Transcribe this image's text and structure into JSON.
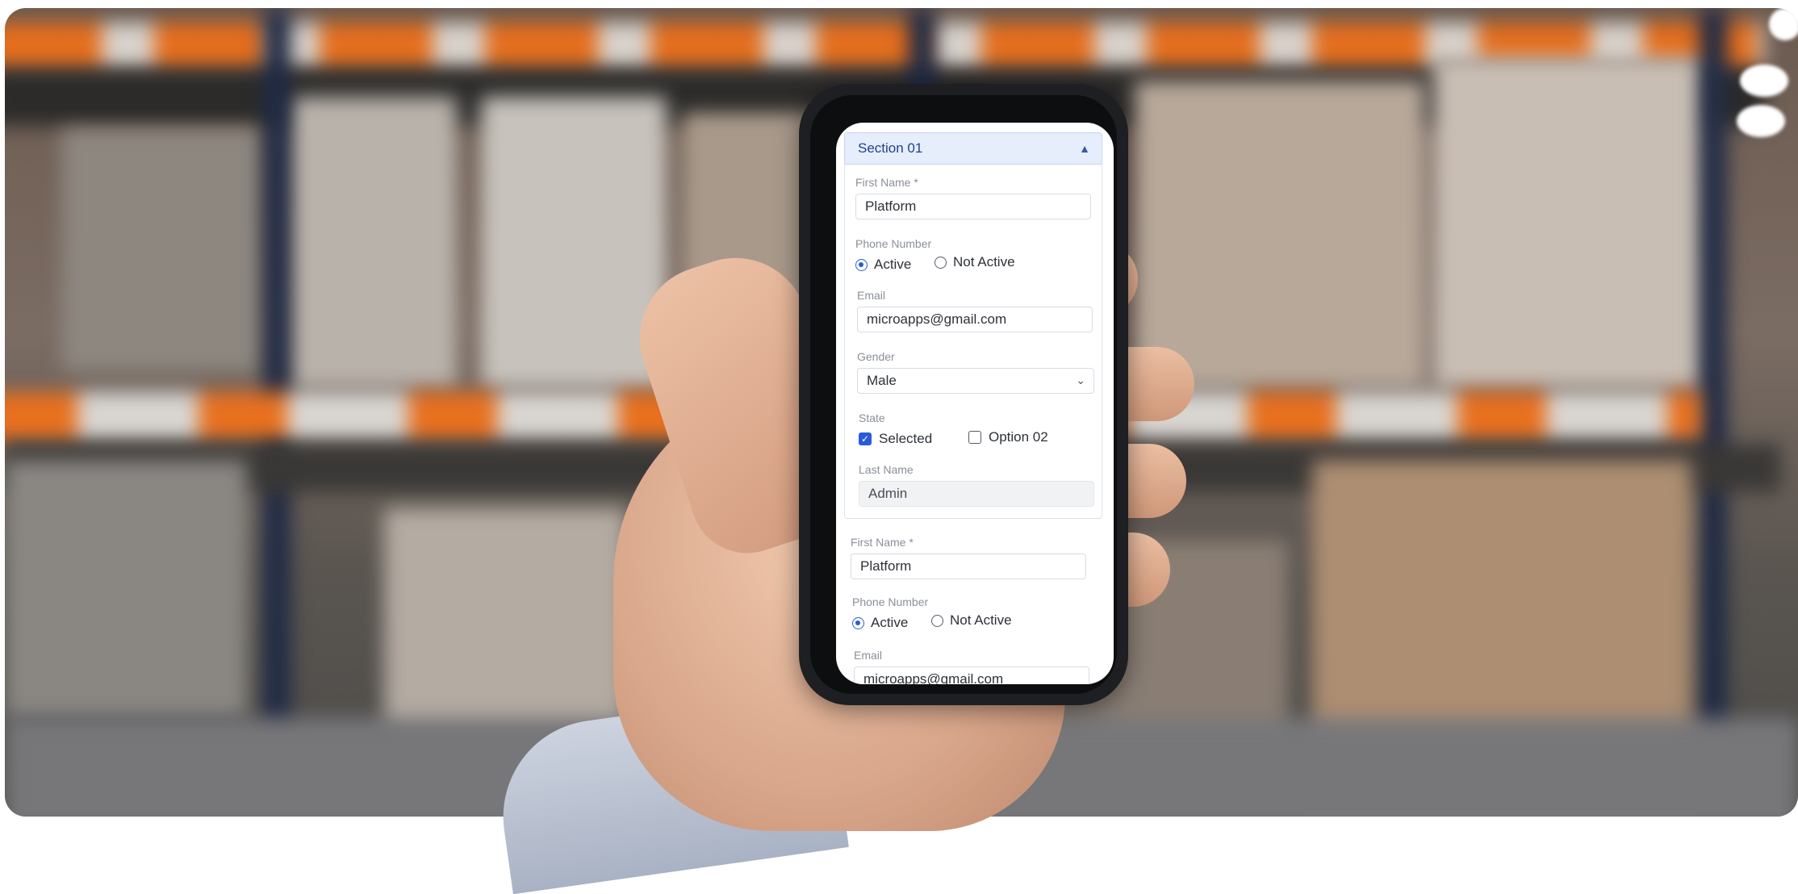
{
  "section": {
    "title": "Section 01"
  },
  "form1": {
    "first_name_label": "First Name *",
    "first_name_value": "Platform",
    "phone_label": "Phone Number",
    "radio_active": "Active",
    "radio_not_active": "Not Active",
    "email_label": "Email",
    "email_value": "microapps@gmail.com",
    "gender_label": "Gender",
    "gender_value": "Male",
    "state_label": "State",
    "check_selected": "Selected",
    "check_option2": "Option 02",
    "last_name_label": "Last Name",
    "last_name_value": "Admin"
  },
  "form2": {
    "first_name_label": "First Name *",
    "first_name_value": "Platform",
    "phone_label": "Phone Number",
    "radio_active": "Active",
    "radio_not_active": "Not Active",
    "email_label": "Email",
    "email_value": "microapps@gmail.com"
  },
  "icons": {
    "collapse": "chevron-up-icon",
    "dropdown": "chevron-down-icon",
    "checkmark": "checkmark-icon"
  },
  "colors": {
    "accent": "#2a5bd7",
    "header_bg": "#e6edfb",
    "header_text": "#20438f",
    "rack_orange": "#e46e1e",
    "rack_post": "#1f2a44"
  }
}
